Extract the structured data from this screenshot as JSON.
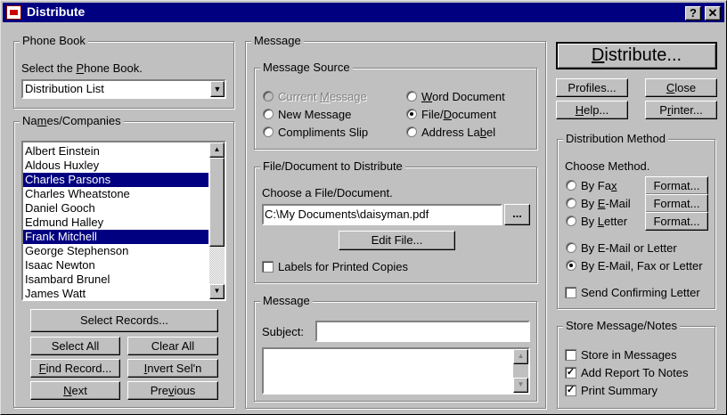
{
  "window": {
    "title": "Distribute",
    "help_btn": "?",
    "close_btn": "✕"
  },
  "phone_book": {
    "group_label": "Phone Book",
    "select_label": "Select the Phone Book.",
    "selected_value": "Distribution List"
  },
  "names": {
    "group_label": "Names/Companies",
    "items": [
      {
        "label": "Albert Einstein",
        "selected": false
      },
      {
        "label": "Aldous Huxley",
        "selected": false
      },
      {
        "label": "Charles Parsons",
        "selected": true
      },
      {
        "label": "Charles Wheatstone",
        "selected": false
      },
      {
        "label": "Daniel Gooch",
        "selected": false
      },
      {
        "label": "Edmund Halley",
        "selected": false
      },
      {
        "label": "Frank Mitchell",
        "selected": true
      },
      {
        "label": "George Stephenson",
        "selected": false
      },
      {
        "label": "Isaac Newton",
        "selected": false
      },
      {
        "label": "Isambard Brunel",
        "selected": false
      },
      {
        "label": "James Watt",
        "selected": false
      }
    ],
    "buttons": {
      "select_records": "Select Records...",
      "select_all": "Select All",
      "clear_all": "Clear All",
      "find_record": "Find Record...",
      "invert_sel": "Invert Sel'n",
      "next": "Next",
      "previous": "Previous"
    }
  },
  "message": {
    "group_label": "Message",
    "source": {
      "group_label": "Message Source",
      "options": {
        "current_message": "Current Message",
        "new_message": "New Message",
        "compliments_slip": "Compliments Slip",
        "word_document": "Word Document",
        "file_document": "File/Document",
        "address_label": "Address Label"
      },
      "selected": "file_document"
    },
    "file": {
      "group_label": "File/Document to Distribute",
      "choose_label": "Choose a File/Document.",
      "path_value": "C:\\My Documents\\daisyman.pdf",
      "browse_label": "...",
      "edit_button": "Edit File...",
      "labels_checkbox": "Labels for Printed Copies",
      "labels_checked": false
    },
    "msg": {
      "group_label": "Message",
      "subject_label": "Subject:",
      "subject_value": "",
      "body_value": ""
    }
  },
  "actions": {
    "distribute": "Distribute...",
    "profiles": "Profiles...",
    "close": "Close",
    "help": "Help...",
    "printer": "Printer..."
  },
  "distribution_method": {
    "group_label": "Distribution Method",
    "choose_label": "Choose Method.",
    "options": {
      "by_fax": "By Fax",
      "by_email": "By E-Mail",
      "by_letter": "By Letter",
      "by_email_or_letter": "By E-Mail or Letter",
      "by_email_fax_letter": "By E-Mail, Fax or Letter"
    },
    "selected": "by_email_fax_letter",
    "format_label": "Format...",
    "send_confirming": "Send Confirming Letter",
    "send_confirming_checked": false
  },
  "store": {
    "group_label": "Store Message/Notes",
    "store_in_messages": "Store in Messages",
    "store_in_messages_checked": false,
    "add_report": "Add Report To Notes",
    "add_report_checked": true,
    "print_summary": "Print Summary",
    "print_summary_checked": true
  }
}
